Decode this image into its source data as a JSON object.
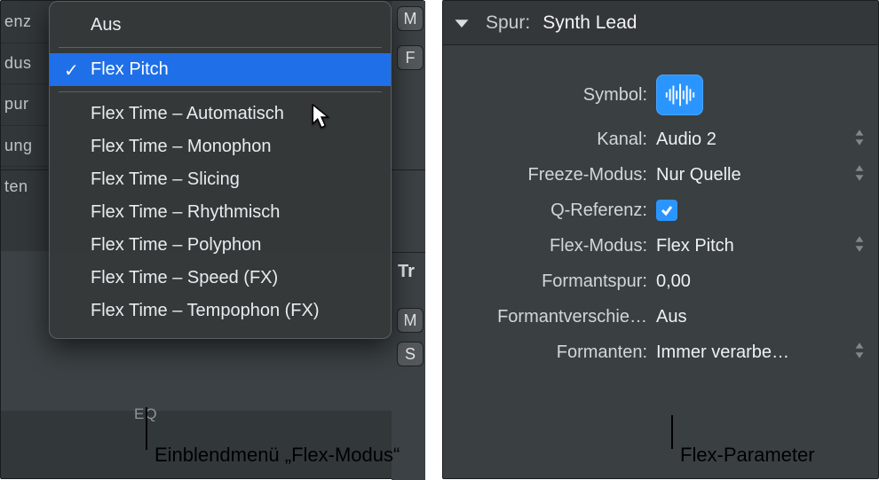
{
  "left": {
    "bg_rows": [
      "enz",
      "dus",
      "pur",
      "ung",
      "ten"
    ],
    "popup": {
      "header": "Aus",
      "items": [
        {
          "label": "Flex Pitch",
          "checked": true,
          "highlight": true
        },
        {
          "label": "Flex Time – Automatisch"
        },
        {
          "label": "Flex Time – Monophon"
        },
        {
          "label": "Flex Time – Slicing"
        },
        {
          "label": "Flex Time – Rhythmisch"
        },
        {
          "label": "Flex Time – Polyphon"
        },
        {
          "label": "Flex Time – Speed (FX)"
        },
        {
          "label": "Flex Time – Tempophon (FX)"
        }
      ]
    },
    "right_strip": {
      "tr_label": "Tr",
      "btn1": "M",
      "btn2": "F",
      "btn3": "M",
      "btn4": "S"
    },
    "eq_text": "EQ"
  },
  "right": {
    "header": {
      "label": "Spur:",
      "value": "Synth Lead"
    },
    "rows": {
      "symbol_label": "Symbol:",
      "kanal": {
        "label": "Kanal:",
        "value": "Audio 2"
      },
      "freeze": {
        "label": "Freeze-Modus:",
        "value": "Nur Quelle"
      },
      "qref": {
        "label": "Q-Referenz:"
      },
      "flexmodus": {
        "label": "Flex-Modus:",
        "value": "Flex Pitch"
      },
      "formantspur": {
        "label": "Formantspur:",
        "value": "0,00"
      },
      "formantversch": {
        "label": "Formantverschie…",
        "value": "Aus"
      },
      "formanten": {
        "label": "Formanten:",
        "value": "Immer verarbe…"
      }
    }
  },
  "callouts": {
    "c1": "Einblendmenü „Flex-Modus“",
    "c2": "Flex-Parameter"
  }
}
